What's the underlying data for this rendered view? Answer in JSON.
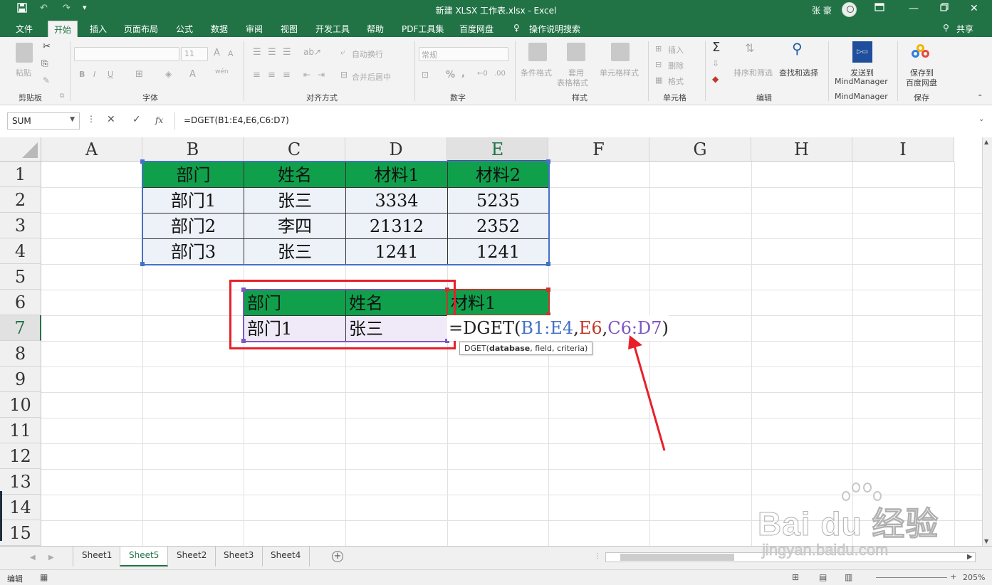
{
  "window": {
    "title": "新建 XLSX 工作表.xlsx  -  Excel",
    "user": "张 豪",
    "quick_access": [
      "save-icon",
      "undo-icon",
      "redo-icon",
      "customize-icon"
    ],
    "controls": [
      "ribbon-display-icon",
      "minimize-icon",
      "restore-icon",
      "close-icon"
    ]
  },
  "menu": {
    "tabs": [
      "文件",
      "开始",
      "插入",
      "页面布局",
      "公式",
      "数据",
      "审阅",
      "视图",
      "开发工具",
      "帮助",
      "PDF工具集",
      "百度网盘"
    ],
    "active": "开始",
    "tell_me": "操作说明搜索",
    "share": "共享"
  },
  "ribbon": {
    "clipboard": {
      "paste": "粘贴",
      "label": "剪贴板"
    },
    "font": {
      "size": "11",
      "bold": "B",
      "italic": "I",
      "underline": "U",
      "label": "字体",
      "grow": "A",
      "shrink": "A",
      "color": "A",
      "phonetic": "wén"
    },
    "alignment": {
      "wrap": "自动换行",
      "merge": "合并后居中",
      "label": "对齐方式"
    },
    "number": {
      "format": "常规",
      "percent": "%",
      "comma": ",",
      "label": "数字"
    },
    "styles": {
      "conditional": "条件格式",
      "table": "套用",
      "table2": "表格格式",
      "cell": "单元格样式",
      "label": "样式"
    },
    "cells": {
      "insert": "插入",
      "delete": "删除",
      "format": "格式",
      "label": "单元格"
    },
    "editing": {
      "sum": "Σ",
      "sort": "排序和筛选",
      "find": "查找和选择",
      "label": "编辑"
    },
    "mindmanager": {
      "send": "发送到",
      "name": "MindManager",
      "label": "MindManager"
    },
    "baidu": {
      "save": "保存到",
      "name": "百度网盘",
      "label": "保存"
    }
  },
  "formula_bar": {
    "name_box": "SUM",
    "cancel": "✕",
    "enter": "✓",
    "fx": "fx",
    "formula": "=DGET(B1:E4,E6,C6:D7)"
  },
  "grid": {
    "columns": [
      "A",
      "B",
      "C",
      "D",
      "E",
      "F",
      "G",
      "H",
      "I"
    ],
    "rows": [
      "1",
      "2",
      "3",
      "4",
      "5",
      "6",
      "7",
      "8",
      "9",
      "10",
      "11",
      "12",
      "13",
      "14",
      "15"
    ],
    "table": {
      "headers": [
        "部门",
        "姓名",
        "材料1",
        "材料2"
      ],
      "rows": [
        [
          "部门1",
          "张三",
          "3334",
          "5235"
        ],
        [
          "部门2",
          "李四",
          "21312",
          "2352"
        ],
        [
          "部门3",
          "张三",
          "1241",
          "1241"
        ]
      ]
    },
    "criteria": {
      "headers": [
        "部门",
        "姓名"
      ],
      "values": [
        "部门1",
        "张三"
      ]
    },
    "field_cell": "材料1",
    "editing_formula": {
      "prefix": "=DGET(",
      "ref1": "B1:E4",
      "sep1": ",",
      "ref2": "E6",
      "sep2": ",",
      "ref3": "C6:D7",
      "suffix": ")"
    },
    "tooltip": {
      "fn": "DGET(",
      "arg1": "database",
      "rest": ", field, criteria)"
    }
  },
  "sheets": {
    "tabs": [
      "Sheet1",
      "Sheet5",
      "Sheet2",
      "Sheet3",
      "Sheet4"
    ],
    "active": "Sheet5",
    "add": "+"
  },
  "status": {
    "mode": "编辑",
    "zoom": "205%"
  },
  "watermark": {
    "brand": "Bai du 经验",
    "url": "jingyan.baidu.com"
  },
  "colors": {
    "excel_green": "#217346",
    "header_fill": "#10a04c",
    "body_fill": "#edf1f8",
    "annotation_red": "#e8202a"
  }
}
